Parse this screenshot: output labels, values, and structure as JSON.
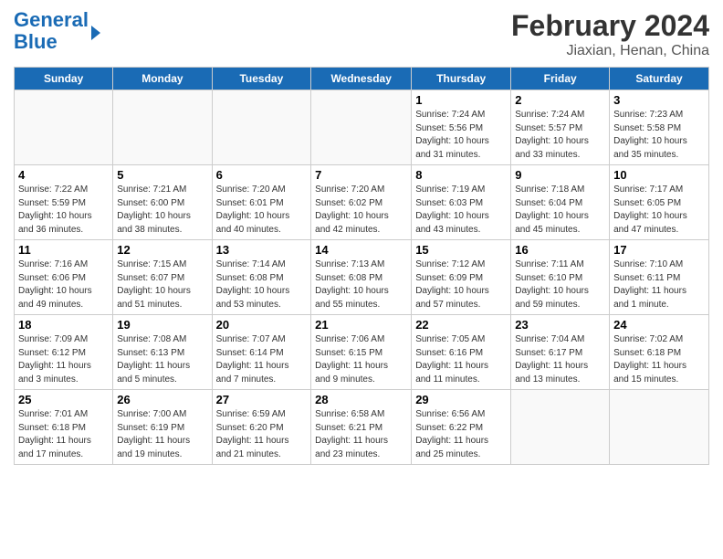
{
  "header": {
    "logo_line1": "General",
    "logo_line2": "Blue",
    "month": "February 2024",
    "location": "Jiaxian, Henan, China"
  },
  "days_of_week": [
    "Sunday",
    "Monday",
    "Tuesday",
    "Wednesday",
    "Thursday",
    "Friday",
    "Saturday"
  ],
  "weeks": [
    [
      {
        "num": "",
        "info": ""
      },
      {
        "num": "",
        "info": ""
      },
      {
        "num": "",
        "info": ""
      },
      {
        "num": "",
        "info": ""
      },
      {
        "num": "1",
        "info": "Sunrise: 7:24 AM\nSunset: 5:56 PM\nDaylight: 10 hours\nand 31 minutes."
      },
      {
        "num": "2",
        "info": "Sunrise: 7:24 AM\nSunset: 5:57 PM\nDaylight: 10 hours\nand 33 minutes."
      },
      {
        "num": "3",
        "info": "Sunrise: 7:23 AM\nSunset: 5:58 PM\nDaylight: 10 hours\nand 35 minutes."
      }
    ],
    [
      {
        "num": "4",
        "info": "Sunrise: 7:22 AM\nSunset: 5:59 PM\nDaylight: 10 hours\nand 36 minutes."
      },
      {
        "num": "5",
        "info": "Sunrise: 7:21 AM\nSunset: 6:00 PM\nDaylight: 10 hours\nand 38 minutes."
      },
      {
        "num": "6",
        "info": "Sunrise: 7:20 AM\nSunset: 6:01 PM\nDaylight: 10 hours\nand 40 minutes."
      },
      {
        "num": "7",
        "info": "Sunrise: 7:20 AM\nSunset: 6:02 PM\nDaylight: 10 hours\nand 42 minutes."
      },
      {
        "num": "8",
        "info": "Sunrise: 7:19 AM\nSunset: 6:03 PM\nDaylight: 10 hours\nand 43 minutes."
      },
      {
        "num": "9",
        "info": "Sunrise: 7:18 AM\nSunset: 6:04 PM\nDaylight: 10 hours\nand 45 minutes."
      },
      {
        "num": "10",
        "info": "Sunrise: 7:17 AM\nSunset: 6:05 PM\nDaylight: 10 hours\nand 47 minutes."
      }
    ],
    [
      {
        "num": "11",
        "info": "Sunrise: 7:16 AM\nSunset: 6:06 PM\nDaylight: 10 hours\nand 49 minutes."
      },
      {
        "num": "12",
        "info": "Sunrise: 7:15 AM\nSunset: 6:07 PM\nDaylight: 10 hours\nand 51 minutes."
      },
      {
        "num": "13",
        "info": "Sunrise: 7:14 AM\nSunset: 6:08 PM\nDaylight: 10 hours\nand 53 minutes."
      },
      {
        "num": "14",
        "info": "Sunrise: 7:13 AM\nSunset: 6:08 PM\nDaylight: 10 hours\nand 55 minutes."
      },
      {
        "num": "15",
        "info": "Sunrise: 7:12 AM\nSunset: 6:09 PM\nDaylight: 10 hours\nand 57 minutes."
      },
      {
        "num": "16",
        "info": "Sunrise: 7:11 AM\nSunset: 6:10 PM\nDaylight: 10 hours\nand 59 minutes."
      },
      {
        "num": "17",
        "info": "Sunrise: 7:10 AM\nSunset: 6:11 PM\nDaylight: 11 hours\nand 1 minute."
      }
    ],
    [
      {
        "num": "18",
        "info": "Sunrise: 7:09 AM\nSunset: 6:12 PM\nDaylight: 11 hours\nand 3 minutes."
      },
      {
        "num": "19",
        "info": "Sunrise: 7:08 AM\nSunset: 6:13 PM\nDaylight: 11 hours\nand 5 minutes."
      },
      {
        "num": "20",
        "info": "Sunrise: 7:07 AM\nSunset: 6:14 PM\nDaylight: 11 hours\nand 7 minutes."
      },
      {
        "num": "21",
        "info": "Sunrise: 7:06 AM\nSunset: 6:15 PM\nDaylight: 11 hours\nand 9 minutes."
      },
      {
        "num": "22",
        "info": "Sunrise: 7:05 AM\nSunset: 6:16 PM\nDaylight: 11 hours\nand 11 minutes."
      },
      {
        "num": "23",
        "info": "Sunrise: 7:04 AM\nSunset: 6:17 PM\nDaylight: 11 hours\nand 13 minutes."
      },
      {
        "num": "24",
        "info": "Sunrise: 7:02 AM\nSunset: 6:18 PM\nDaylight: 11 hours\nand 15 minutes."
      }
    ],
    [
      {
        "num": "25",
        "info": "Sunrise: 7:01 AM\nSunset: 6:18 PM\nDaylight: 11 hours\nand 17 minutes."
      },
      {
        "num": "26",
        "info": "Sunrise: 7:00 AM\nSunset: 6:19 PM\nDaylight: 11 hours\nand 19 minutes."
      },
      {
        "num": "27",
        "info": "Sunrise: 6:59 AM\nSunset: 6:20 PM\nDaylight: 11 hours\nand 21 minutes."
      },
      {
        "num": "28",
        "info": "Sunrise: 6:58 AM\nSunset: 6:21 PM\nDaylight: 11 hours\nand 23 minutes."
      },
      {
        "num": "29",
        "info": "Sunrise: 6:56 AM\nSunset: 6:22 PM\nDaylight: 11 hours\nand 25 minutes."
      },
      {
        "num": "",
        "info": ""
      },
      {
        "num": "",
        "info": ""
      }
    ]
  ]
}
